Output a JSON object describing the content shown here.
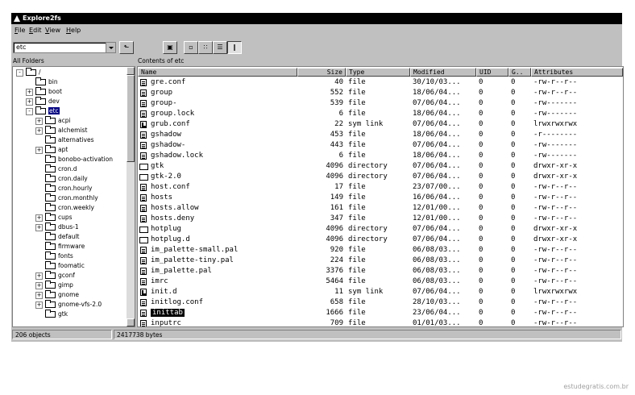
{
  "window": {
    "title": "Explore2fs"
  },
  "menu": [
    {
      "label": "File",
      "u": "F",
      "rest": "ile"
    },
    {
      "label": "Edit",
      "u": "E",
      "rest": "dit"
    },
    {
      "label": "View",
      "u": "V",
      "rest": "iew"
    },
    {
      "label": "Help",
      "u": "H",
      "rest": "elp"
    }
  ],
  "toolbar": {
    "path_value": "etc"
  },
  "left_header": "All Folders",
  "right_header": "Contents of etc",
  "tree": [
    {
      "label": "/",
      "exp": "-"
    },
    {
      "label": "bin",
      "exp": ""
    },
    {
      "label": "boot",
      "exp": "+"
    },
    {
      "label": "dev",
      "exp": "+"
    },
    {
      "label": "etc",
      "exp": "-",
      "selected": true
    },
    {
      "label": "acpi",
      "exp": "+"
    },
    {
      "label": "alchemist",
      "exp": "+"
    },
    {
      "label": "alternatives",
      "exp": ""
    },
    {
      "label": "apt",
      "exp": "+"
    },
    {
      "label": "bonobo-activation",
      "exp": ""
    },
    {
      "label": "cron.d",
      "exp": ""
    },
    {
      "label": "cron.daily",
      "exp": ""
    },
    {
      "label": "cron.hourly",
      "exp": ""
    },
    {
      "label": "cron.monthly",
      "exp": ""
    },
    {
      "label": "cron.weekly",
      "exp": ""
    },
    {
      "label": "cups",
      "exp": "+"
    },
    {
      "label": "dbus-1",
      "exp": "+"
    },
    {
      "label": "default",
      "exp": ""
    },
    {
      "label": "firmware",
      "exp": ""
    },
    {
      "label": "fonts",
      "exp": ""
    },
    {
      "label": "foomatic",
      "exp": ""
    },
    {
      "label": "gconf",
      "exp": "+"
    },
    {
      "label": "gimp",
      "exp": "+"
    },
    {
      "label": "gnome",
      "exp": "+"
    },
    {
      "label": "gnome-vfs-2.0",
      "exp": "+"
    },
    {
      "label": "gtk",
      "exp": ""
    }
  ],
  "columns": [
    "Name",
    "Size",
    "Type",
    "Modified",
    "UID",
    "G..",
    "Attributes"
  ],
  "files": [
    {
      "icon": "file",
      "name": "gre.conf",
      "size": "40",
      "type": "file",
      "modified": "30/10/03...",
      "uid": "0",
      "gid": "0",
      "attr": "-rw-r--r--"
    },
    {
      "icon": "file",
      "name": "group",
      "size": "552",
      "type": "file",
      "modified": "18/06/04...",
      "uid": "0",
      "gid": "0",
      "attr": "-rw-r--r--"
    },
    {
      "icon": "file",
      "name": "group-",
      "size": "539",
      "type": "file",
      "modified": "07/06/04...",
      "uid": "0",
      "gid": "0",
      "attr": "-rw-------"
    },
    {
      "icon": "file",
      "name": "group.lock",
      "size": "6",
      "type": "file",
      "modified": "18/06/04...",
      "uid": "0",
      "gid": "0",
      "attr": "-rw-------"
    },
    {
      "icon": "link",
      "name": "grub.conf",
      "size": "22",
      "type": "sym link",
      "modified": "07/06/04...",
      "uid": "0",
      "gid": "0",
      "attr": "lrwxrwxrwx"
    },
    {
      "icon": "file",
      "name": "gshadow",
      "size": "453",
      "type": "file",
      "modified": "18/06/04...",
      "uid": "0",
      "gid": "0",
      "attr": "-r--------"
    },
    {
      "icon": "file",
      "name": "gshadow-",
      "size": "443",
      "type": "file",
      "modified": "07/06/04...",
      "uid": "0",
      "gid": "0",
      "attr": "-rw-------"
    },
    {
      "icon": "file",
      "name": "gshadow.lock",
      "size": "6",
      "type": "file",
      "modified": "18/06/04...",
      "uid": "0",
      "gid": "0",
      "attr": "-rw-------"
    },
    {
      "icon": "dir",
      "name": "gtk",
      "size": "4096",
      "type": "directory",
      "modified": "07/06/04...",
      "uid": "0",
      "gid": "0",
      "attr": "drwxr-xr-x"
    },
    {
      "icon": "dir",
      "name": "gtk-2.0",
      "size": "4096",
      "type": "directory",
      "modified": "07/06/04...",
      "uid": "0",
      "gid": "0",
      "attr": "drwxr-xr-x"
    },
    {
      "icon": "file",
      "name": "host.conf",
      "size": "17",
      "type": "file",
      "modified": "23/07/00...",
      "uid": "0",
      "gid": "0",
      "attr": "-rw-r--r--"
    },
    {
      "icon": "file",
      "name": "hosts",
      "size": "149",
      "type": "file",
      "modified": "16/06/04...",
      "uid": "0",
      "gid": "0",
      "attr": "-rw-r--r--"
    },
    {
      "icon": "file",
      "name": "hosts.allow",
      "size": "161",
      "type": "file",
      "modified": "12/01/00...",
      "uid": "0",
      "gid": "0",
      "attr": "-rw-r--r--"
    },
    {
      "icon": "file",
      "name": "hosts.deny",
      "size": "347",
      "type": "file",
      "modified": "12/01/00...",
      "uid": "0",
      "gid": "0",
      "attr": "-rw-r--r--"
    },
    {
      "icon": "dir",
      "name": "hotplug",
      "size": "4096",
      "type": "directory",
      "modified": "07/06/04...",
      "uid": "0",
      "gid": "0",
      "attr": "drwxr-xr-x"
    },
    {
      "icon": "dir",
      "name": "hotplug.d",
      "size": "4096",
      "type": "directory",
      "modified": "07/06/04...",
      "uid": "0",
      "gid": "0",
      "attr": "drwxr-xr-x"
    },
    {
      "icon": "file",
      "name": "im_palette-small.pal",
      "size": "920",
      "type": "file",
      "modified": "06/08/03...",
      "uid": "0",
      "gid": "0",
      "attr": "-rw-r--r--"
    },
    {
      "icon": "file",
      "name": "im_palette-tiny.pal",
      "size": "224",
      "type": "file",
      "modified": "06/08/03...",
      "uid": "0",
      "gid": "0",
      "attr": "-rw-r--r--"
    },
    {
      "icon": "file",
      "name": "im_palette.pal",
      "size": "3376",
      "type": "file",
      "modified": "06/08/03...",
      "uid": "0",
      "gid": "0",
      "attr": "-rw-r--r--"
    },
    {
      "icon": "file",
      "name": "imrc",
      "size": "5464",
      "type": "file",
      "modified": "06/08/03...",
      "uid": "0",
      "gid": "0",
      "attr": "-rw-r--r--"
    },
    {
      "icon": "link",
      "name": "init.d",
      "size": "11",
      "type": "sym link",
      "modified": "07/06/04...",
      "uid": "0",
      "gid": "0",
      "attr": "lrwxrwxrwx"
    },
    {
      "icon": "file",
      "name": "initlog.conf",
      "size": "658",
      "type": "file",
      "modified": "28/10/03...",
      "uid": "0",
      "gid": "0",
      "attr": "-rw-r--r--"
    },
    {
      "icon": "file",
      "name": "inittab",
      "size": "1666",
      "type": "file",
      "modified": "23/06/04...",
      "uid": "0",
      "gid": "0",
      "attr": "-rw-r--r--",
      "selected": true
    },
    {
      "icon": "file",
      "name": "inputrc",
      "size": "709",
      "type": "file",
      "modified": "01/01/03...",
      "uid": "0",
      "gid": "0",
      "attr": "-rw-r--r--"
    }
  ],
  "status": {
    "objects": "206 objects",
    "bytes": "2417738 bytes"
  },
  "watermark": "estudegratis.com.br"
}
